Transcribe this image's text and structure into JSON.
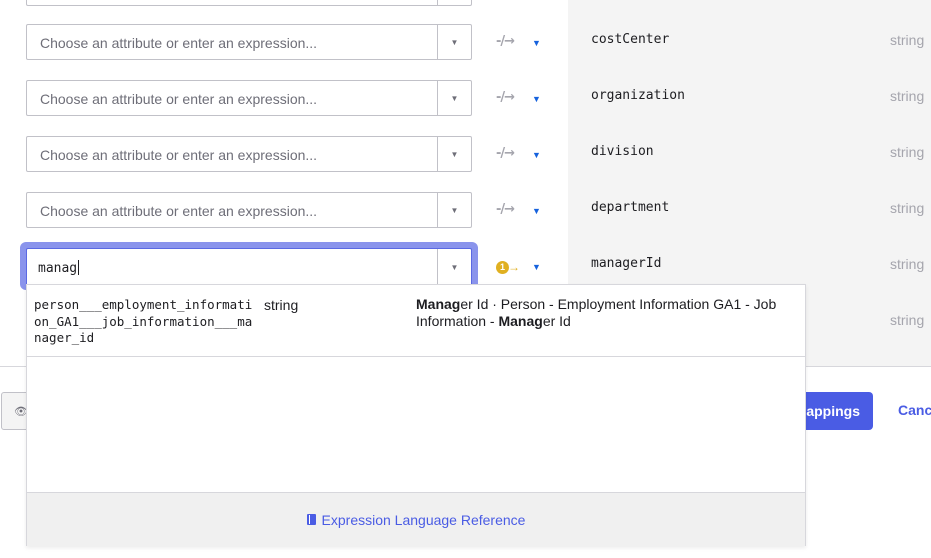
{
  "mapping_rows": [
    {
      "placeholder": "Choose an attribute or enter an expression...",
      "attribute": "costCenter",
      "type": "string"
    },
    {
      "placeholder": "Choose an attribute or enter an expression...",
      "attribute": "organization",
      "type": "string"
    },
    {
      "placeholder": "Choose an attribute or enter an expression...",
      "attribute": "division",
      "type": "string"
    },
    {
      "placeholder": "Choose an attribute or enter an expression...",
      "attribute": "department",
      "type": "string"
    }
  ],
  "active_row": {
    "input_value": "manag",
    "attribute": "managerId",
    "type": "string",
    "warning_badge": "1"
  },
  "hidden_row_type": "string",
  "icons": {
    "dropdown_caret": "▼",
    "push_caret": "▼",
    "mapping_arrow": "-/→",
    "warning_arrow": "→",
    "eye": "👁"
  },
  "dropdown": {
    "options": [
      {
        "name": "person___employment_information_GA1___job_information___manager_id",
        "type": "string",
        "desc_parts": [
          {
            "text": "Manag",
            "bold": true
          },
          {
            "text": "er Id · Person - Employment Information GA1 - Job Information - ",
            "bold": false
          },
          {
            "text": "Manag",
            "bold": true
          },
          {
            "text": "er Id",
            "bold": false
          }
        ]
      }
    ],
    "footer_link": "Expression Language Reference"
  },
  "footer": {
    "save_label": "Save Mappings",
    "cancel_label": "Cancel"
  },
  "colors": {
    "accent": "#4a5ce4",
    "warning": "#e0b021",
    "panel_bg": "#f4f4f4"
  }
}
